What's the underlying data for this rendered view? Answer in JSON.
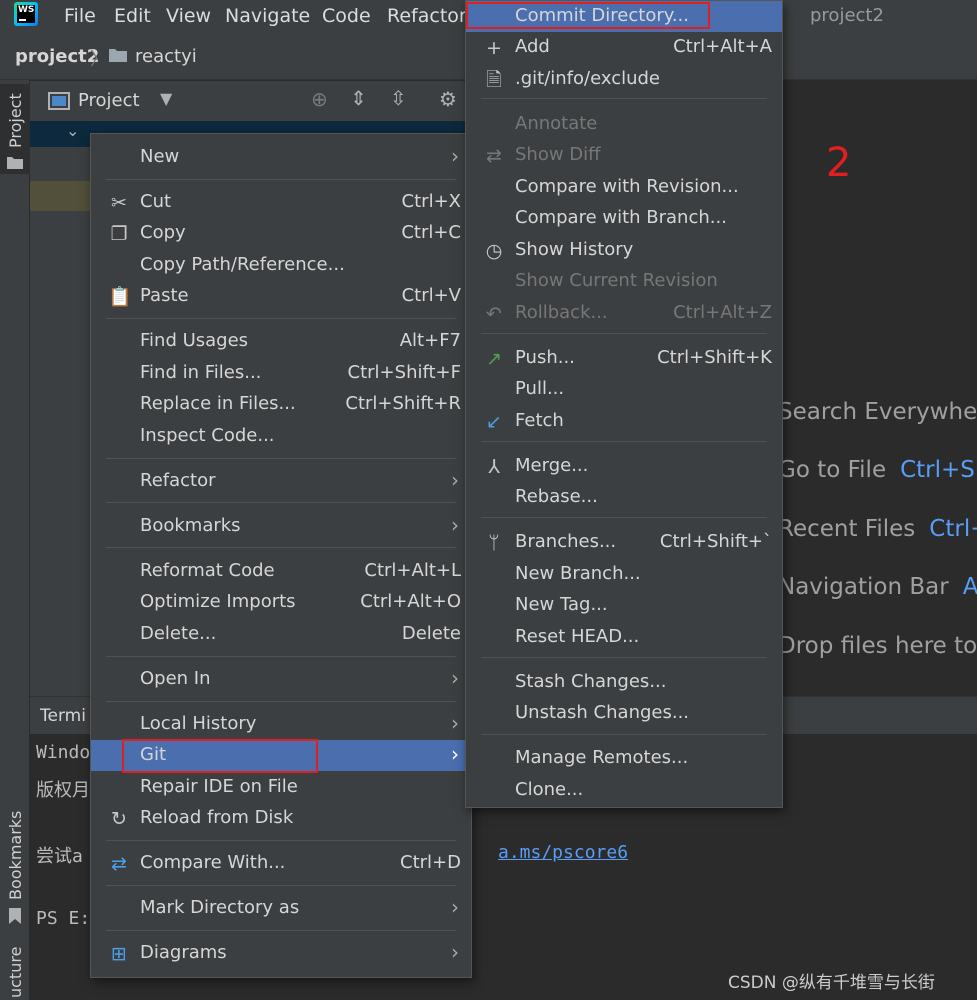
{
  "menubar": {
    "items": [
      {
        "label": "File"
      },
      {
        "label": "Edit"
      },
      {
        "label": "View"
      },
      {
        "label": "Navigate"
      },
      {
        "label": "Code"
      },
      {
        "label": "Refactor"
      }
    ],
    "window_title": "project2",
    "logo_text": "WS"
  },
  "breadcrumb": {
    "project": "project2",
    "folder": "reactyi"
  },
  "tool_windows": {
    "project": "Project",
    "bookmarks": "Bookmarks",
    "structure": "ucture"
  },
  "project_panel": {
    "title": "Project"
  },
  "terminal": {
    "title": "Termi",
    "lines": [
      "Windo",
      "版权月",
      "尝试a",
      "PS E:"
    ],
    "link": "a.ms/pscore6"
  },
  "editor_hints": [
    {
      "label": "Search Everywher",
      "key": ""
    },
    {
      "label": "Go to File",
      "key": "Ctrl+Sh"
    },
    {
      "label": "Recent Files",
      "key": "Ctrl+"
    },
    {
      "label": "Navigation Bar",
      "key": "Al"
    },
    {
      "label": "Drop files here to",
      "key": ""
    }
  ],
  "annotation_number": "2",
  "context_menu": {
    "new": "New",
    "cut": "Cut",
    "cut_sc": "Ctrl+X",
    "copy": "Copy",
    "copy_sc": "Ctrl+C",
    "copy_path": "Copy Path/Reference...",
    "paste": "Paste",
    "paste_sc": "Ctrl+V",
    "find_usages": "Find Usages",
    "find_usages_sc": "Alt+F7",
    "find_in_files": "Find in Files...",
    "find_in_files_sc": "Ctrl+Shift+F",
    "replace_in_files": "Replace in Files...",
    "replace_in_files_sc": "Ctrl+Shift+R",
    "inspect_code": "Inspect Code...",
    "refactor": "Refactor",
    "bookmarks": "Bookmarks",
    "reformat_code": "Reformat Code",
    "reformat_code_sc": "Ctrl+Alt+L",
    "optimize_imports": "Optimize Imports",
    "optimize_imports_sc": "Ctrl+Alt+O",
    "delete": "Delete...",
    "delete_sc": "Delete",
    "open_in": "Open In",
    "local_history": "Local History",
    "git": "Git",
    "repair_ide": "Repair IDE on File",
    "reload_disk": "Reload from Disk",
    "compare_with": "Compare With...",
    "compare_with_sc": "Ctrl+D",
    "mark_directory": "Mark Directory as",
    "diagrams": "Diagrams"
  },
  "git_menu": {
    "commit_directory": "Commit Directory...",
    "add": "Add",
    "add_sc": "Ctrl+Alt+A",
    "exclude": ".git/info/exclude",
    "annotate": "Annotate",
    "show_diff": "Show Diff",
    "compare_revision": "Compare with Revision...",
    "compare_branch": "Compare with Branch...",
    "show_history": "Show History",
    "show_current_revision": "Show Current Revision",
    "rollback": "Rollback...",
    "rollback_sc": "Ctrl+Alt+Z",
    "push": "Push...",
    "push_sc": "Ctrl+Shift+K",
    "pull": "Pull...",
    "fetch": "Fetch",
    "merge": "Merge...",
    "rebase": "Rebase...",
    "branches": "Branches...",
    "branches_sc": "Ctrl+Shift+`",
    "new_branch": "New Branch...",
    "new_tag": "New Tag...",
    "reset_head": "Reset HEAD...",
    "stash": "Stash Changes...",
    "unstash": "Unstash Changes...",
    "manage_remotes": "Manage Remotes...",
    "clone": "Clone..."
  },
  "watermark": "CSDN @纵有千堆雪与长街",
  "colors": {
    "selection": "#4b6eaf",
    "annotation_red": "#e02020",
    "link_blue": "#589df6"
  }
}
